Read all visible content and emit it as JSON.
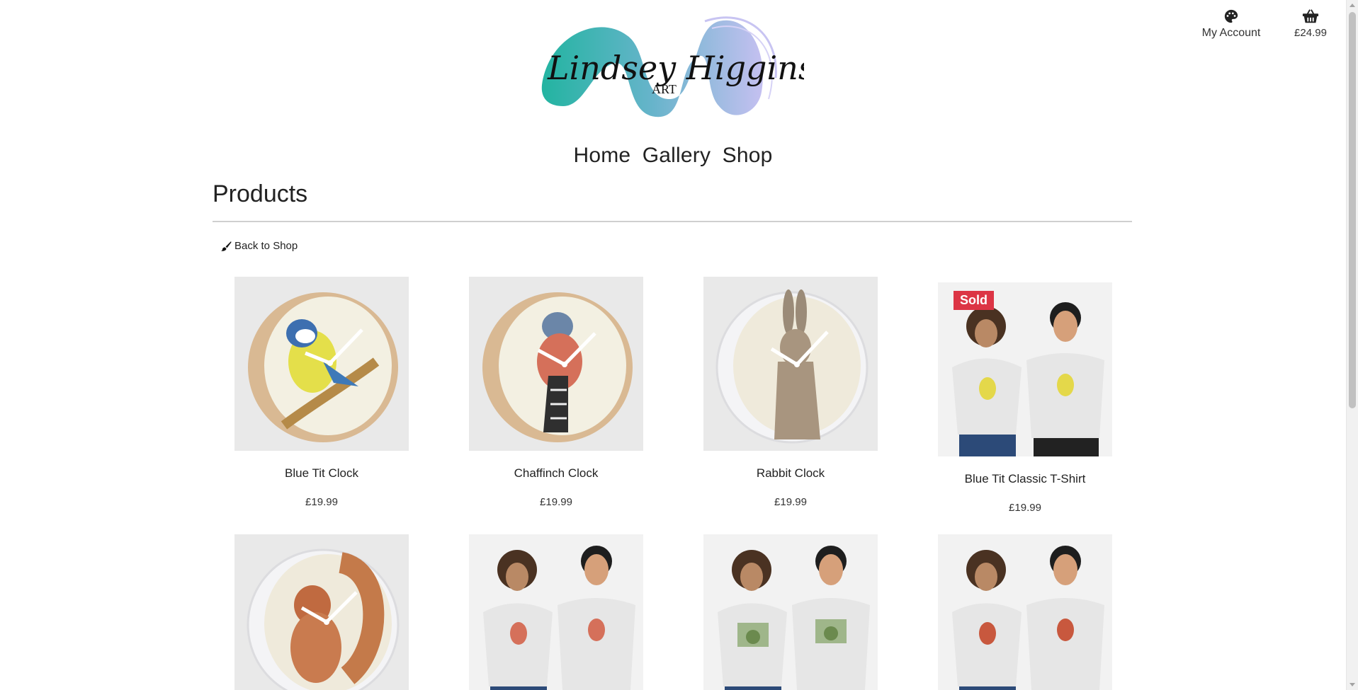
{
  "header": {
    "logo_text": "Lindsey Higginson",
    "logo_sub": "ART",
    "account_label": "My Account",
    "cart_total": "£24.99"
  },
  "nav": {
    "items": [
      {
        "label": "Home"
      },
      {
        "label": "Gallery"
      },
      {
        "label": "Shop"
      }
    ]
  },
  "page": {
    "title": "Products",
    "back_label": "Back to Shop"
  },
  "products": [
    {
      "name": "Blue Tit Clock",
      "price": "£19.99",
      "type": "clock",
      "subject": "blue-tit"
    },
    {
      "name": "Chaffinch Clock",
      "price": "£19.99",
      "type": "clock",
      "subject": "chaffinch"
    },
    {
      "name": "Rabbit Clock",
      "price": "£19.99",
      "type": "clock",
      "subject": "rabbit"
    },
    {
      "name": "Blue Tit Classic T-Shirt",
      "price": "£19.99",
      "type": "tshirt",
      "subject": "blue-tit",
      "badge": "Sold"
    },
    {
      "name": "",
      "price": "",
      "type": "clock",
      "subject": "squirrel"
    },
    {
      "name": "",
      "price": "",
      "type": "tshirt",
      "subject": "chaffinch"
    },
    {
      "name": "",
      "price": "",
      "type": "tshirt",
      "subject": "hobbit-door"
    },
    {
      "name": "",
      "price": "",
      "type": "tshirt",
      "subject": "robin"
    }
  ],
  "colors": {
    "sold_badge": "#dc3545",
    "logo_teal": "#1fb3a0",
    "logo_lavender": "#b8b4ec"
  }
}
